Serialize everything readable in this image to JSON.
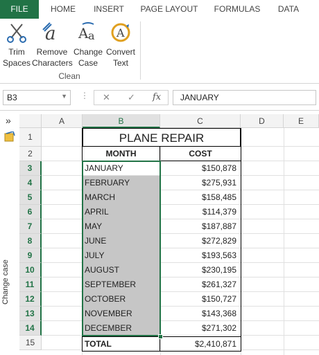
{
  "ribbon_tabs": [
    "FILE",
    "HOME",
    "INSERT",
    "PAGE LAYOUT",
    "FORMULAS",
    "DATA"
  ],
  "ribbon": {
    "buttons": [
      {
        "label_line1": "Trim",
        "label_line2": "Spaces",
        "icon": "scissors-icon"
      },
      {
        "label_line1": "Remove",
        "label_line2": "Characters",
        "icon": "remove-characters-icon"
      },
      {
        "label_line1": "Change",
        "label_line2": "Case",
        "icon": "change-case-icon"
      },
      {
        "label_line1": "Convert",
        "label_line2": "Text",
        "icon": "convert-text-icon"
      }
    ],
    "group_label": "Clean"
  },
  "formula_bar": {
    "name_box": "B3",
    "cancel_symbol": "✕",
    "enter_symbol": "✓",
    "fx_symbol": "fx",
    "content": "JANUARY"
  },
  "side_pane": {
    "expand_symbol": "»",
    "title": "Change case"
  },
  "columns": [
    "A",
    "B",
    "C",
    "D",
    "E"
  ],
  "selected_column": "B",
  "rows": [
    "1",
    "2",
    "3",
    "4",
    "5",
    "6",
    "7",
    "8",
    "9",
    "10",
    "11",
    "12",
    "13",
    "14",
    "15"
  ],
  "sheet": {
    "title": "PLANE REPAIR",
    "headers": {
      "month": "MONTH",
      "cost": "COST"
    },
    "data": [
      {
        "month": "JANUARY",
        "cost": "$150,878"
      },
      {
        "month": "FEBRUARY",
        "cost": "$275,931"
      },
      {
        "month": "MARCH",
        "cost": "$158,485"
      },
      {
        "month": "APRIL",
        "cost": "$114,379"
      },
      {
        "month": "MAY",
        "cost": "$187,887"
      },
      {
        "month": "JUNE",
        "cost": "$272,829"
      },
      {
        "month": "JULY",
        "cost": "$193,563"
      },
      {
        "month": "AUGUST",
        "cost": "$230,195"
      },
      {
        "month": "SEPTEMBER",
        "cost": "$261,327"
      },
      {
        "month": "OCTOBER",
        "cost": "$150,727"
      },
      {
        "month": "NOVEMBER",
        "cost": "$143,368"
      },
      {
        "month": "DECEMBER",
        "cost": "$271,302"
      }
    ],
    "total": {
      "label": "TOTAL",
      "value": "$2,410,871"
    }
  },
  "colors": {
    "accent": "#217346",
    "selection_fill": "#c6c6c6"
  }
}
